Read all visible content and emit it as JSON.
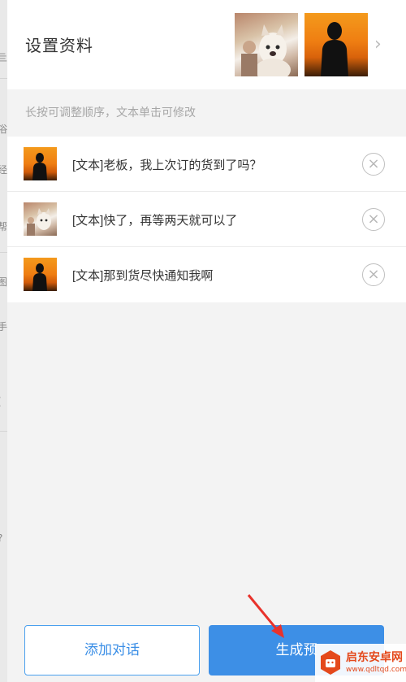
{
  "header": {
    "title": "设置资料",
    "avatars": [
      {
        "kind": "cat-photo"
      },
      {
        "kind": "silhouette-sunset"
      }
    ],
    "chevron_icon": "chevron-right-icon"
  },
  "hint": "长按可调整顺序，文本单击可修改",
  "messages": [
    {
      "avatar": "silhouette-sunset",
      "text": "[文本]老板，我上次订的货到了吗？"
    },
    {
      "avatar": "cat-photo",
      "text": "[文本]快了，再等两天就可以了"
    },
    {
      "avatar": "silhouette-sunset",
      "text": "[文本]那到货尽快通知我啊"
    }
  ],
  "delete_glyph": "×",
  "footer": {
    "add_label": "添加对话",
    "generate_label": "生成预"
  },
  "watermark": {
    "name": "启东安卓网",
    "url": "www.qdltqd.com"
  },
  "colors": {
    "accent": "#3d8fe6",
    "accent_border": "#4aa0ee",
    "annotation_arrow": "#e8322b",
    "watermark": "#e4491c"
  }
}
